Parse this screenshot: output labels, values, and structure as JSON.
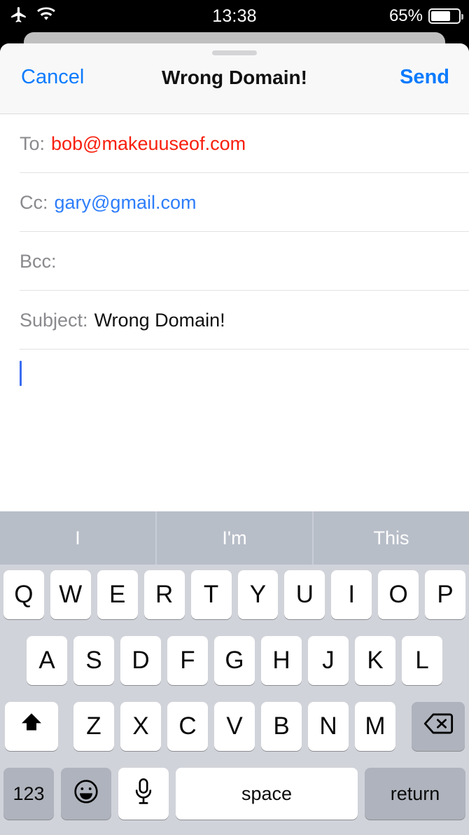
{
  "status_bar": {
    "airplane_icon": "airplane-icon",
    "wifi_icon": "wifi-icon",
    "time": "13:38",
    "battery_percent": "65%",
    "battery_level": 65
  },
  "nav_bar": {
    "cancel_label": "Cancel",
    "title": "Wrong Domain!",
    "send_label": "Send"
  },
  "compose": {
    "fields": [
      {
        "label": "To:",
        "value": "bob@makeuuseof.com",
        "state": "invalid"
      },
      {
        "label": "Cc:",
        "value": "gary@gmail.com",
        "state": "valid"
      },
      {
        "label": "Bcc:",
        "value": "",
        "state": "empty"
      },
      {
        "label": "Subject:",
        "value": "Wrong Domain!",
        "state": "normal"
      }
    ],
    "body_text": ""
  },
  "keyboard": {
    "predictions": [
      "I",
      "I'm",
      "This"
    ],
    "row1": [
      "Q",
      "W",
      "E",
      "R",
      "T",
      "Y",
      "U",
      "I",
      "O",
      "P"
    ],
    "row2": [
      "A",
      "S",
      "D",
      "F",
      "G",
      "H",
      "J",
      "K",
      "L"
    ],
    "row3": [
      "Z",
      "X",
      "C",
      "V",
      "B",
      "N",
      "M"
    ],
    "shift_icon": "shift-arrow-icon",
    "backspace_icon": "backspace-icon",
    "numbers_label": "123",
    "emoji_icon": "emoji-smiley-icon",
    "mic_icon": "microphone-icon",
    "space_label": "space",
    "return_label": "return"
  },
  "colors": {
    "accent_blue": "#0b7bff",
    "invalid_red": "#f81f0e",
    "valid_blue": "#2d7dfa",
    "keyboard_bg": "#d1d3da",
    "predictive_bg": "#b8bec8",
    "key_white": "#ffffff",
    "key_dark": "#aeb3bd"
  }
}
